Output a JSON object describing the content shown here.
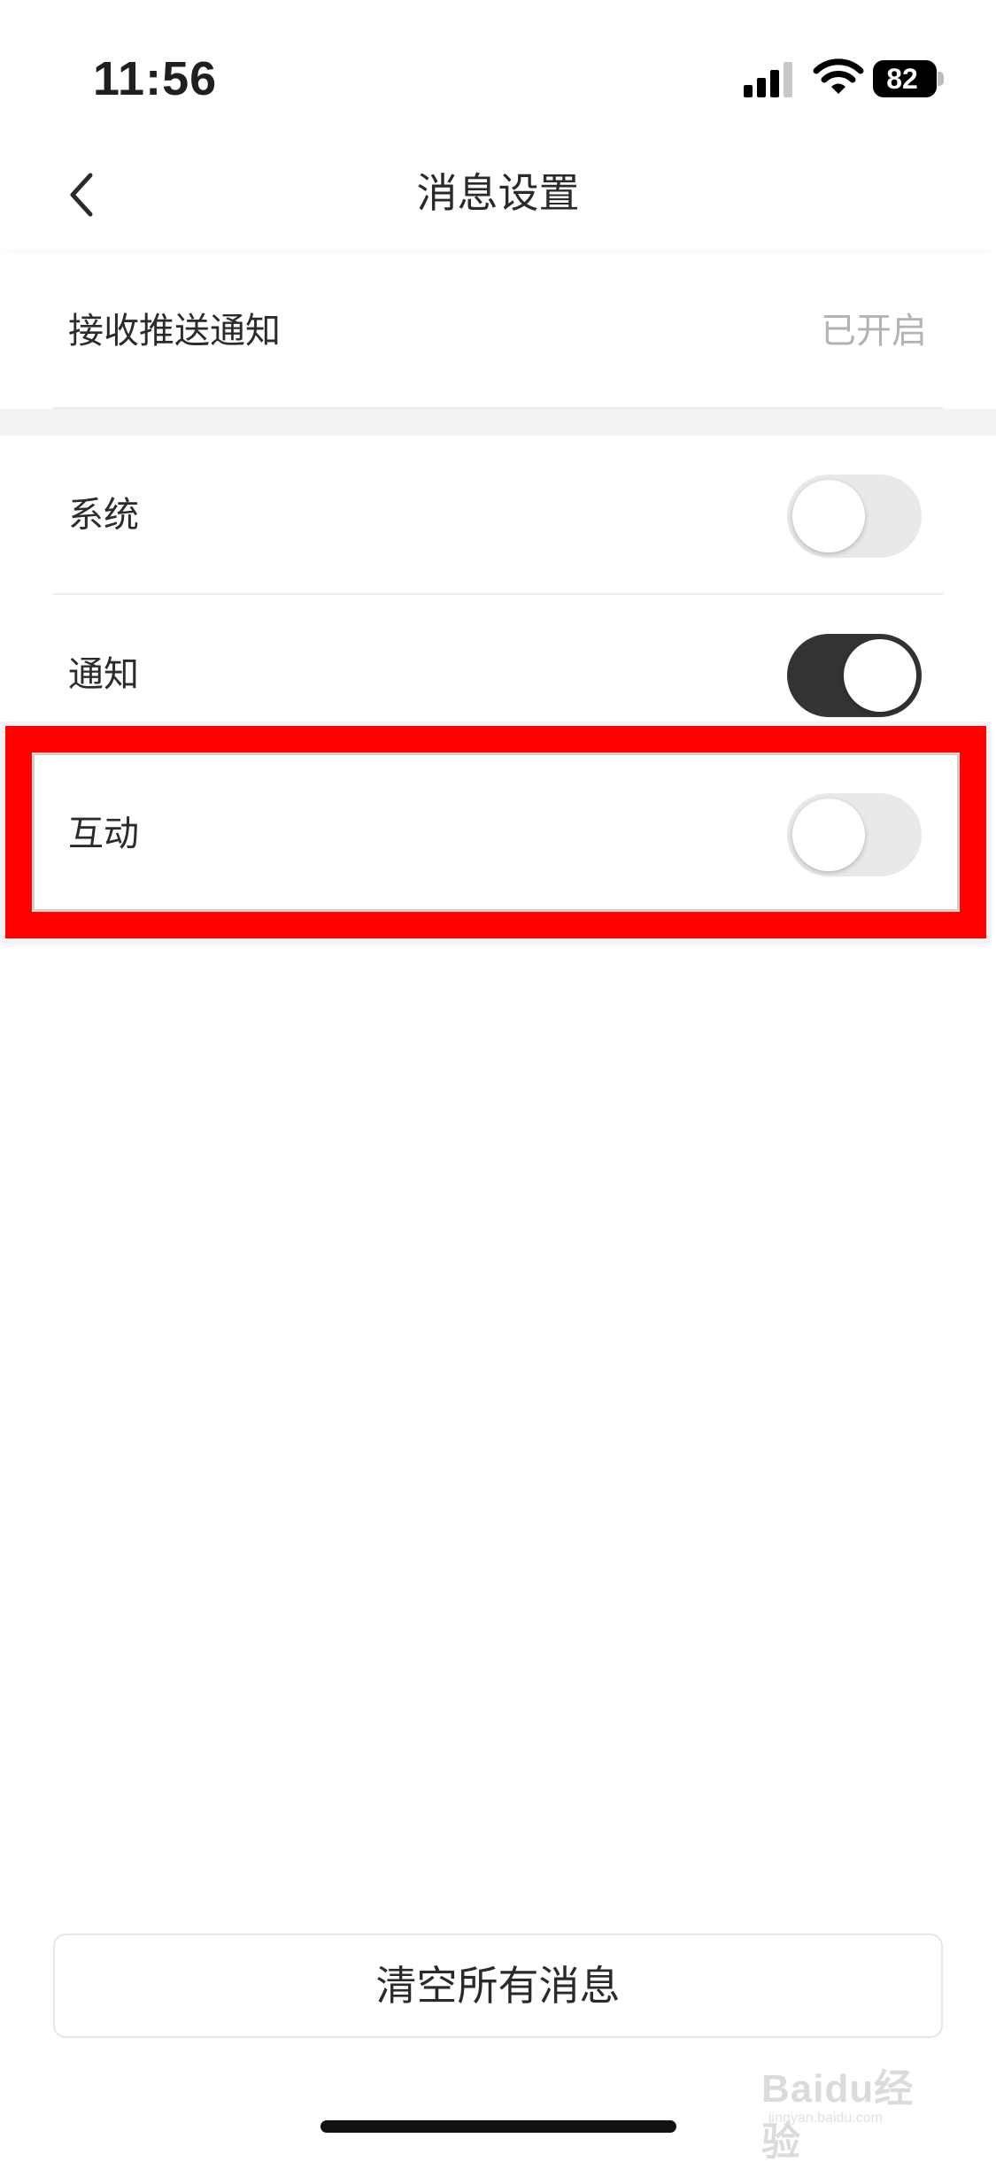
{
  "status_bar": {
    "time": "11:56",
    "battery": "82"
  },
  "nav": {
    "title": "消息设置"
  },
  "push_row": {
    "label": "接收推送通知",
    "value": "已开启"
  },
  "toggles": [
    {
      "label": "系统",
      "on": false
    },
    {
      "label": "通知",
      "on": true
    },
    {
      "label": "互动",
      "on": false
    }
  ],
  "clear_button": {
    "label": "清空所有消息"
  },
  "watermark": {
    "text": "Baidu经验",
    "sub": "jingyan.baidu.com"
  },
  "colors": {
    "highlight": "#ff0000",
    "toggle_on": "#333333",
    "toggle_off": "#e9e9e9"
  }
}
